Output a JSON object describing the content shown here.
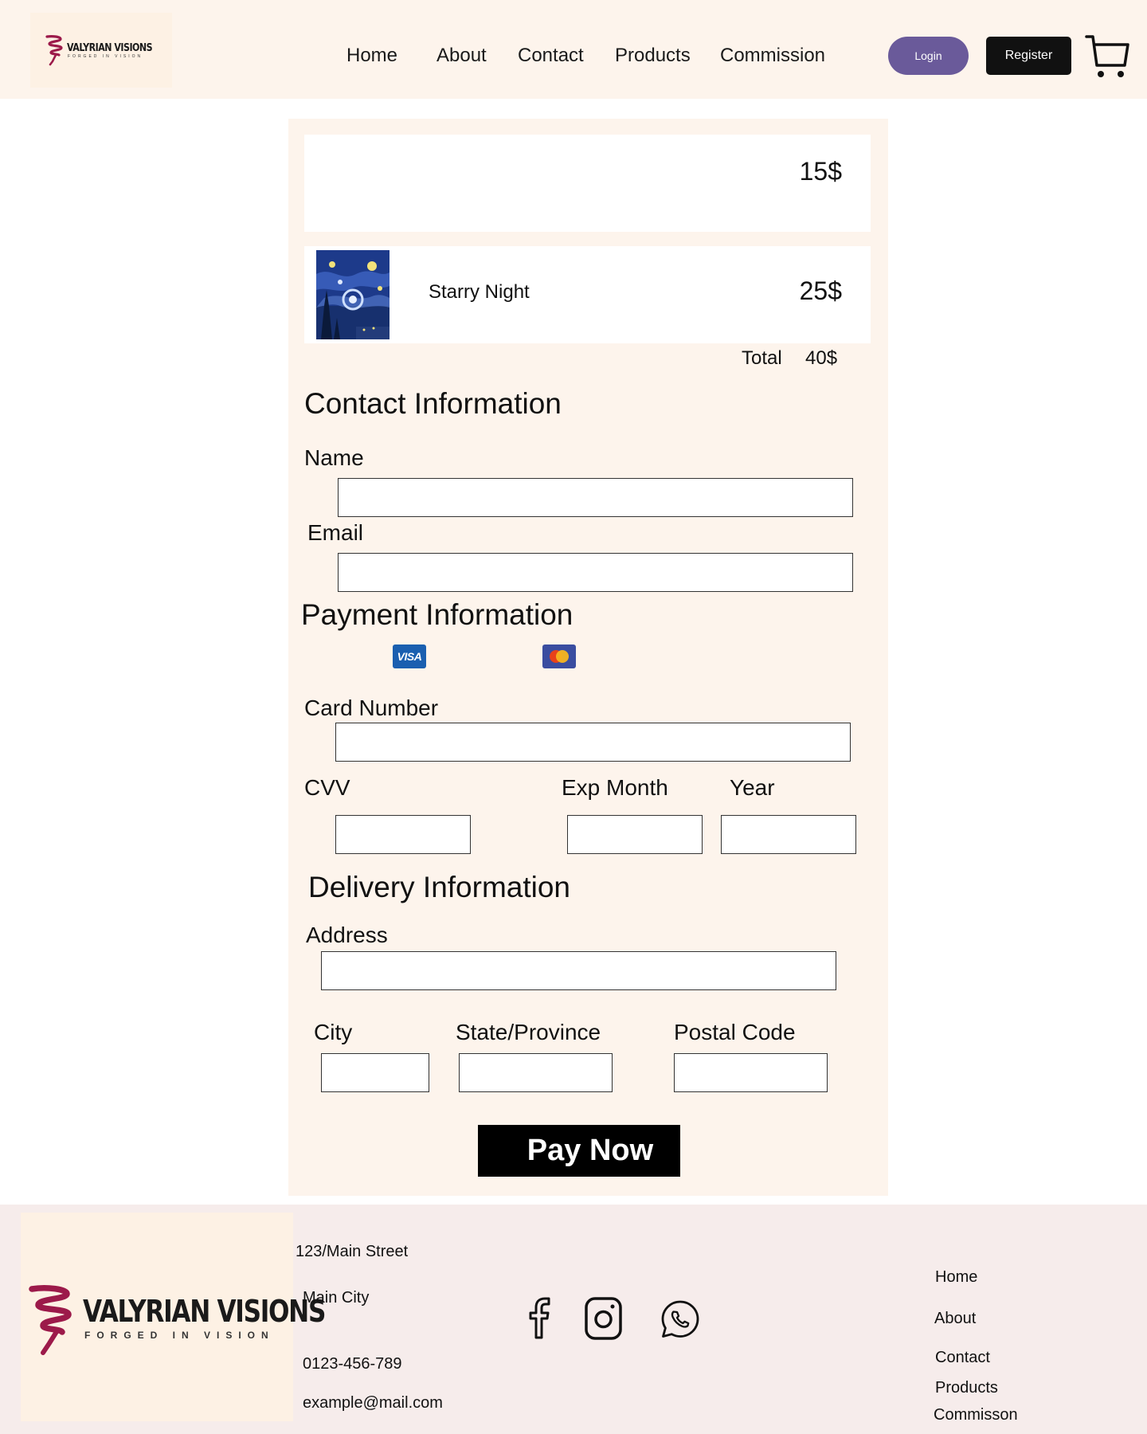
{
  "header": {
    "brand": {
      "name": "VALYRIAN VISIONS",
      "tagline": "FORGED IN VISION"
    },
    "nav": [
      "Home",
      "About",
      "Contact",
      "Products",
      "Commission"
    ],
    "login_label": "Login",
    "register_label": "Register"
  },
  "order": {
    "items": [
      {
        "name": "",
        "price": "15$"
      },
      {
        "name": "Starry Night",
        "price": "25$"
      }
    ],
    "total_label": "Total",
    "total_value": "40$"
  },
  "contact": {
    "title": "Contact Information",
    "name_label": "Name",
    "email_label": "Email"
  },
  "payment": {
    "title": "Payment Information",
    "card_icons": [
      "visa-icon",
      "mastercard-icon"
    ],
    "visa_text": "VISA",
    "card_number_label": "Card Number",
    "cvv_label": "CVV",
    "exp_month_label": "Exp Month",
    "year_label": "Year"
  },
  "delivery": {
    "title": "Delivery Information",
    "address_label": "Address",
    "city_label": "City",
    "state_label": "State/Province",
    "postal_label": "Postal Code"
  },
  "pay_button_label": "Pay Now",
  "footer": {
    "brand": {
      "name": "VALYRIAN VISIONS",
      "tagline": "FORGED IN VISION"
    },
    "address_line1": "123/Main Street",
    "address_line2": "Main City",
    "phone": "0123-456-789",
    "email": "example@mail.com",
    "social_icons": [
      "facebook-icon",
      "instagram-icon",
      "whatsapp-icon"
    ],
    "links": [
      "Home",
      "About",
      "Contact",
      "Products",
      "Commisson"
    ]
  },
  "colors": {
    "header_bg": "#fdf4ec",
    "panel_bg": "#fdf4ec",
    "footer_bg": "#f6eceb",
    "login_button": "#6a5a9a",
    "brand_accent": "#9c1a4a"
  }
}
